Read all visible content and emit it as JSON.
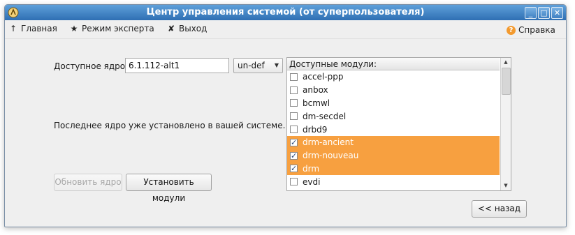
{
  "window": {
    "title": "Центр управления системой (от суперпользователя)",
    "controls": {
      "minimize": "_",
      "maximize": "□",
      "close": "✕"
    }
  },
  "toolbar": {
    "home": {
      "icon": "arrow-up-icon",
      "glyph": "↑",
      "label": "Главная"
    },
    "expert": {
      "icon": "star-icon",
      "glyph": "★",
      "label": "Режим эксперта"
    },
    "exit": {
      "icon": "exit-icon",
      "glyph": "✘",
      "label": "Выход"
    },
    "help": {
      "icon": "help-icon",
      "glyph": "?",
      "label": "Справка"
    }
  },
  "kernel": {
    "label": "Доступное ядро:",
    "value": "6.1.112-alt1",
    "flavour": "un-def",
    "status": "Последнее ядро уже установлено в вашей системе."
  },
  "buttons": {
    "update_kernel": "Обновить ядро",
    "install_modules": "Установить модули",
    "back": "<<  назад"
  },
  "modules": {
    "header": "Доступные модули:",
    "items": [
      {
        "name": "accel-ppp",
        "checked": false,
        "selected": false
      },
      {
        "name": "anbox",
        "checked": false,
        "selected": false
      },
      {
        "name": "bcmwl",
        "checked": false,
        "selected": false
      },
      {
        "name": "dm-secdel",
        "checked": false,
        "selected": false
      },
      {
        "name": "drbd9",
        "checked": false,
        "selected": false
      },
      {
        "name": "drm-ancient",
        "checked": true,
        "selected": true
      },
      {
        "name": "drm-nouveau",
        "checked": true,
        "selected": true
      },
      {
        "name": "drm",
        "checked": true,
        "selected": true
      },
      {
        "name": "evdi",
        "checked": false,
        "selected": false
      }
    ]
  },
  "colors": {
    "selection": "#f7a040",
    "titlebar": "#3a7fc4",
    "help_icon": "#f39a2e"
  }
}
